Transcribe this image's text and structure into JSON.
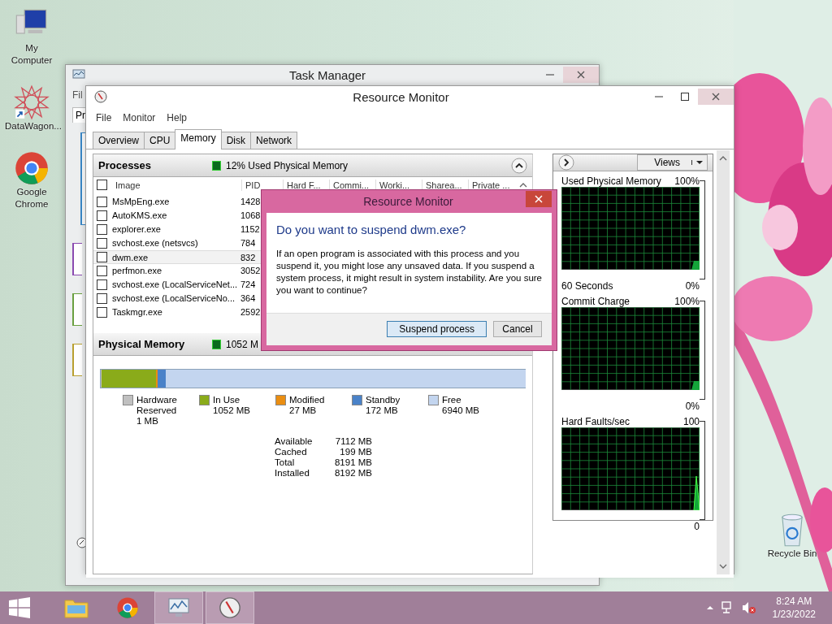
{
  "desktop_icons": [
    {
      "label": "My Computer",
      "kind": "computer"
    },
    {
      "label": "DataWagon...",
      "kind": "star"
    },
    {
      "label": "Google Chrome",
      "kind": "chrome"
    }
  ],
  "recycle_bin": {
    "label": "Recycle Bin"
  },
  "task_manager": {
    "title": "Task Manager",
    "menu_fragment": "Fil",
    "tab_fragment": "Pr"
  },
  "resource_monitor": {
    "title": "Resource Monitor",
    "menu": [
      "File",
      "Monitor",
      "Help"
    ],
    "tabs": [
      {
        "label": "Overview",
        "selected": false
      },
      {
        "label": "CPU",
        "selected": false
      },
      {
        "label": "Memory",
        "selected": true
      },
      {
        "label": "Disk",
        "selected": false
      },
      {
        "label": "Network",
        "selected": false
      }
    ],
    "processes": {
      "title": "Processes",
      "summary": "12% Used Physical Memory",
      "select_all_checked": false,
      "columns": [
        "Image",
        "PID",
        "Hard F...",
        "Commi...",
        "Worki...",
        "Sharea...",
        "Private ..."
      ],
      "rows": [
        {
          "image": "MsMpEng.exe",
          "pid": "1428",
          "checked": false,
          "selected": false
        },
        {
          "image": "AutoKMS.exe",
          "pid": "1068",
          "checked": false,
          "selected": false
        },
        {
          "image": "explorer.exe",
          "pid": "1152",
          "checked": false,
          "selected": false
        },
        {
          "image": "svchost.exe (netsvcs)",
          "pid": "784",
          "checked": false,
          "selected": false
        },
        {
          "image": "dwm.exe",
          "pid": "832",
          "checked": false,
          "selected": true
        },
        {
          "image": "perfmon.exe",
          "pid": "3052",
          "checked": false,
          "selected": false
        },
        {
          "image": "svchost.exe (LocalServiceNet...",
          "pid": "724",
          "checked": false,
          "selected": false
        },
        {
          "image": "svchost.exe (LocalServiceNo...",
          "pid": "364",
          "checked": false,
          "selected": false
        },
        {
          "image": "Taskmgr.exe",
          "pid": "2592",
          "checked": false,
          "selected": false
        }
      ]
    },
    "physical_memory": {
      "title": "Physical Memory",
      "summary": "1052 M",
      "bar": [
        {
          "color": "#c0c0c0",
          "level": 0.0001
        },
        {
          "color": "#8aab1a",
          "level": 0.128
        },
        {
          "color": "#ea8e12",
          "level": 0.0033
        },
        {
          "color": "#4a82c8",
          "level": 0.021
        },
        {
          "color": "#c3d5ef",
          "level": 0.847
        }
      ],
      "legend": [
        {
          "label": "Hardware Reserved",
          "value": "1 MB",
          "color": "#c0c0c0"
        },
        {
          "label": "In Use",
          "value": "1052 MB",
          "color": "#8aab1a"
        },
        {
          "label": "Modified",
          "value": "27 MB",
          "color": "#ea8e12"
        },
        {
          "label": "Standby",
          "value": "172 MB",
          "color": "#4a82c8"
        },
        {
          "label": "Free",
          "value": "6940 MB",
          "color": "#c3d5ef"
        }
      ],
      "stats": [
        {
          "label": "Available",
          "value": "7112 MB"
        },
        {
          "label": "Cached",
          "value": "199 MB"
        },
        {
          "label": "Total",
          "value": "8191 MB"
        },
        {
          "label": "Installed",
          "value": "8192 MB"
        }
      ]
    },
    "views_button": "Views",
    "graphs": [
      {
        "title": "Used Physical Memory",
        "max": "100%",
        "min": "0%",
        "footer": "60 Seconds",
        "kind": "plateau"
      },
      {
        "title": "Commit Charge",
        "max": "100%",
        "min": "0%",
        "kind": "plateau"
      },
      {
        "title": "Hard Faults/sec",
        "max": "100",
        "min": "0",
        "kind": "spike"
      }
    ]
  },
  "dialog": {
    "title": "Resource Monitor",
    "heading": "Do you want to suspend dwm.exe?",
    "body": "If an open program is associated with this process and you suspend it, you might lose any unsaved data. If you suspend a system process, it might result in system instability. Are you sure you want to continue?",
    "buttons": [
      {
        "label": "Suspend process",
        "default": true
      },
      {
        "label": "Cancel",
        "default": false
      }
    ]
  },
  "taskbar": {
    "apps": [
      {
        "kind": "explorer",
        "active": false
      },
      {
        "kind": "chrome",
        "active": false
      },
      {
        "kind": "perfmon",
        "active": true
      },
      {
        "kind": "resmon",
        "active": true
      }
    ],
    "time": "8:24 AM",
    "date": "1/23/2022"
  }
}
